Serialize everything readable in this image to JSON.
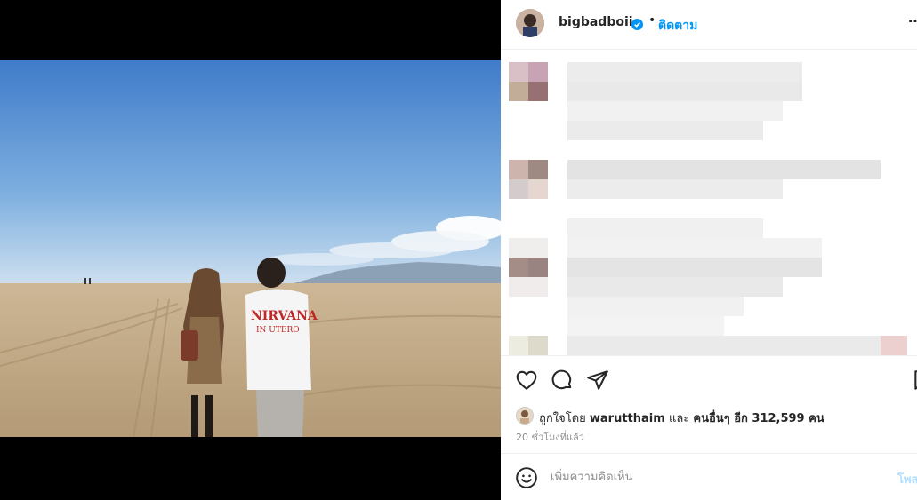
{
  "post": {
    "image_alt": "Couple walking hand in hand on a beach"
  },
  "header": {
    "username": "bigbadboii",
    "verified": true,
    "separator": "•",
    "follow_label": "ติดตาม",
    "more_label": "⋯"
  },
  "likes": {
    "prefix": "ถูกใจโดย",
    "liker": "warutthaim",
    "middle": "และ",
    "others_label": "คนอื่นๆ อีก 312,599 คน"
  },
  "timestamp": "20 ชั่วโมงที่แล้ว",
  "comment_box": {
    "placeholder": "เพิ่มความคิดเห็น",
    "post_label": "โพสต์"
  },
  "icons": {
    "like": "heart-icon",
    "comment": "comment-icon",
    "share": "send-icon",
    "save": "bookmark-icon",
    "emoji": "emoji-icon",
    "verified": "verified-badge-icon"
  },
  "colors": {
    "accent": "#0095f6",
    "muted": "#8e8e8e",
    "text": "#262626",
    "divider": "#efefef"
  }
}
